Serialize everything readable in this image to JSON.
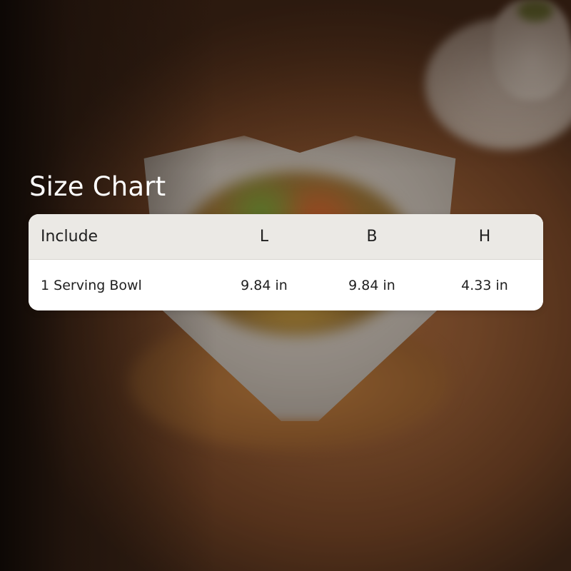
{
  "title": "Size Chart",
  "table": {
    "headers": [
      "Include",
      "L",
      "B",
      "H"
    ],
    "rows": [
      [
        "1 Serving Bowl",
        "9.84 in",
        "9.84 in",
        "4.33 in"
      ]
    ]
  },
  "colors": {
    "title_text": "#ffffff",
    "header_background": "#ebe9e5",
    "body_background": "#ffffff",
    "cell_text": "#1f1f1f"
  }
}
